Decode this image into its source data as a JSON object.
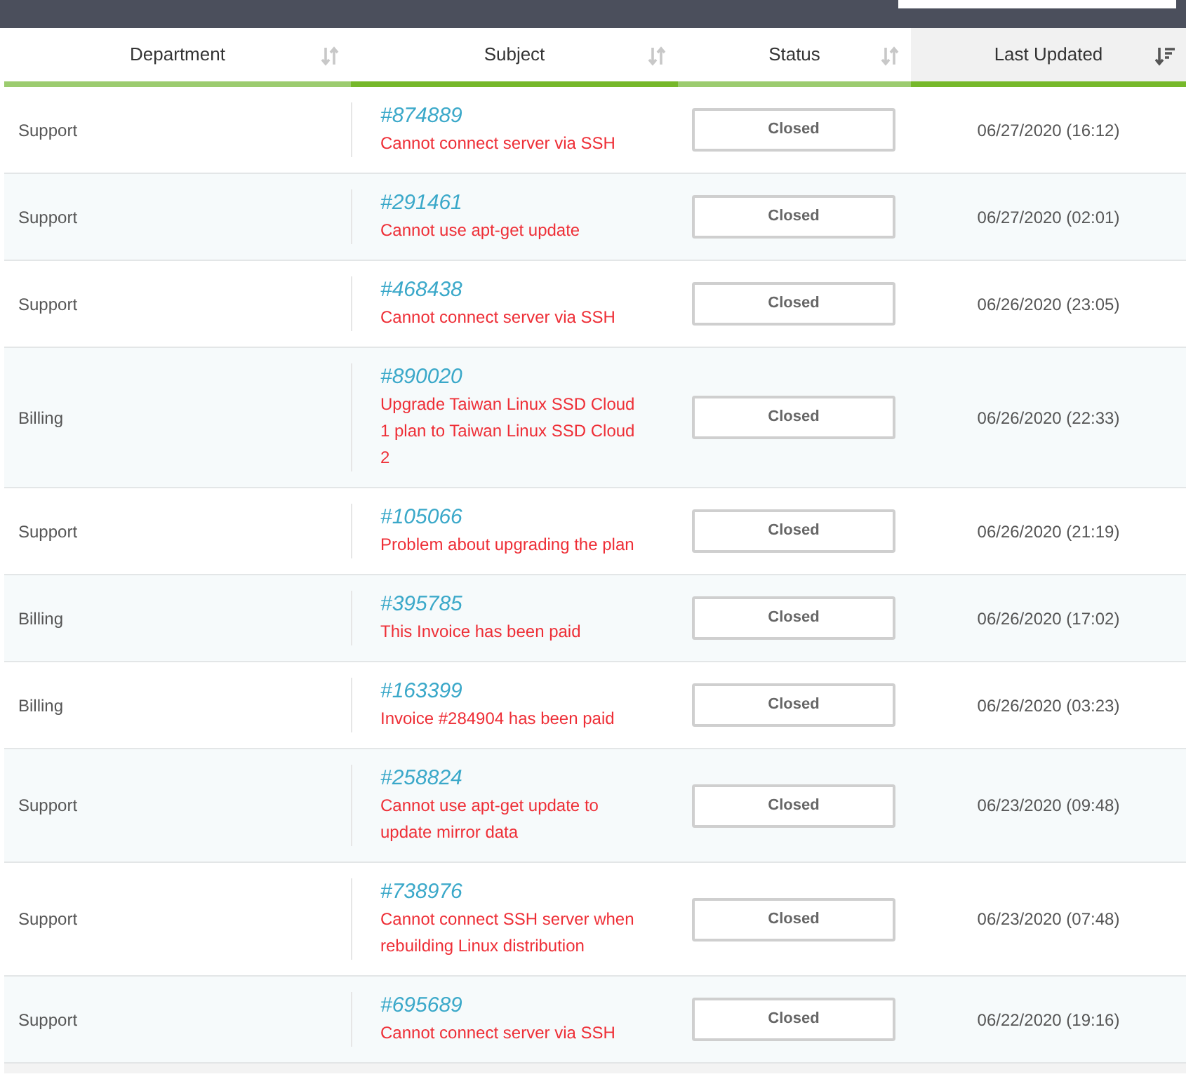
{
  "columns": [
    {
      "label": "Department",
      "sorted": false
    },
    {
      "label": "Subject",
      "sorted": false
    },
    {
      "label": "Status",
      "sorted": false
    },
    {
      "label": "Last Updated",
      "sorted": true
    }
  ],
  "rows": [
    {
      "department": "Support",
      "ticket": "#874889",
      "subject": "Cannot connect server via SSH",
      "status": "Closed",
      "updated": "06/27/2020 (16:12)"
    },
    {
      "department": "Support",
      "ticket": "#291461",
      "subject": "Cannot use apt-get update",
      "status": "Closed",
      "updated": "06/27/2020 (02:01)"
    },
    {
      "department": "Support",
      "ticket": "#468438",
      "subject": "Cannot connect server via SSH",
      "status": "Closed",
      "updated": "06/26/2020 (23:05)"
    },
    {
      "department": "Billing",
      "ticket": "#890020",
      "subject": "Upgrade Taiwan Linux SSD Cloud 1 plan to Taiwan Linux SSD Cloud 2",
      "status": "Closed",
      "updated": "06/26/2020 (22:33)"
    },
    {
      "department": "Support",
      "ticket": "#105066",
      "subject": "Problem about upgrading the plan",
      "status": "Closed",
      "updated": "06/26/2020 (21:19)"
    },
    {
      "department": "Billing",
      "ticket": "#395785",
      "subject": "This Invoice has been paid",
      "status": "Closed",
      "updated": "06/26/2020 (17:02)"
    },
    {
      "department": "Billing",
      "ticket": "#163399",
      "subject": "Invoice #284904 has been paid",
      "status": "Closed",
      "updated": "06/26/2020 (03:23)"
    },
    {
      "department": "Support",
      "ticket": "#258824",
      "subject": "Cannot use apt-get update to update mirror data",
      "status": "Closed",
      "updated": "06/23/2020 (09:48)"
    },
    {
      "department": "Support",
      "ticket": "#738976",
      "subject": "Cannot connect SSH server when rebuilding Linux distribution",
      "status": "Closed",
      "updated": "06/23/2020 (07:48)"
    },
    {
      "department": "Support",
      "ticket": "#695689",
      "subject": "Cannot connect server via SSH",
      "status": "Closed",
      "updated": "06/22/2020 (19:16)"
    }
  ]
}
